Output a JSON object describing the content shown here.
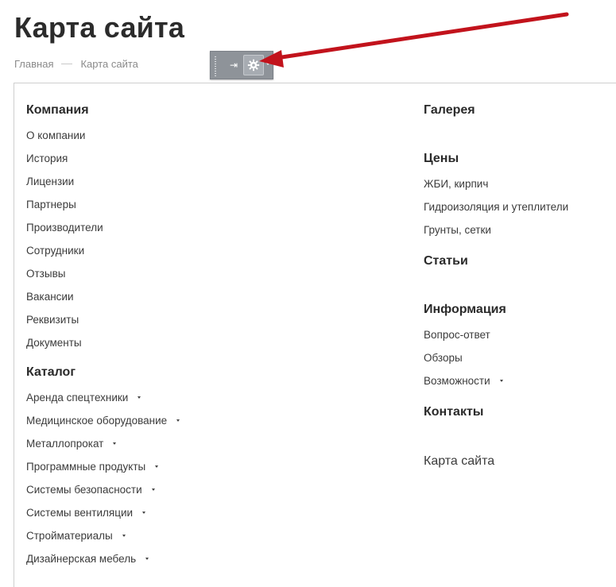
{
  "page": {
    "title": "Карта сайта",
    "breadcrumb": [
      "Главная",
      "Карта сайта"
    ]
  },
  "toolbar": {
    "pin_icon": "pin-icon",
    "settings_icon": "gear-icon",
    "dropdown_icon": "chevron-down-icon",
    "pin_glyph": "⇥"
  },
  "colors": {
    "arrow": "#c2131c",
    "title": "#2b2b2b",
    "breadcrumb": "#8a8a8a",
    "toolbar_bg": "#8e9399"
  },
  "left_column": {
    "company": {
      "title": "Компания",
      "items": [
        "О компании",
        "История",
        "Лицензии",
        "Партнеры",
        "Производители",
        "Сотрудники",
        "Отзывы",
        "Вакансии",
        "Реквизиты",
        "Документы"
      ]
    },
    "catalog": {
      "title": "Каталог",
      "items": [
        "Аренда спецтехники",
        "Медицинское оборудование",
        "Металлопрокат",
        "Программные продукты",
        "Системы безопасности",
        "Системы вентиляции",
        "Стройматериалы",
        "Дизайнерская мебель"
      ]
    }
  },
  "right_column": {
    "gallery": {
      "title": "Галерея"
    },
    "prices": {
      "title": "Цены",
      "items": [
        "ЖБИ, кирпич",
        "Гидроизоляция и утеплители",
        "Грунты, сетки"
      ]
    },
    "articles": {
      "title": "Статьи"
    },
    "info": {
      "title": "Информация",
      "items": [
        "Вопрос-ответ",
        "Обзоры",
        "Возможности"
      ]
    },
    "contacts": {
      "title": "Контакты"
    },
    "sitemap_link": "Карта сайта"
  }
}
